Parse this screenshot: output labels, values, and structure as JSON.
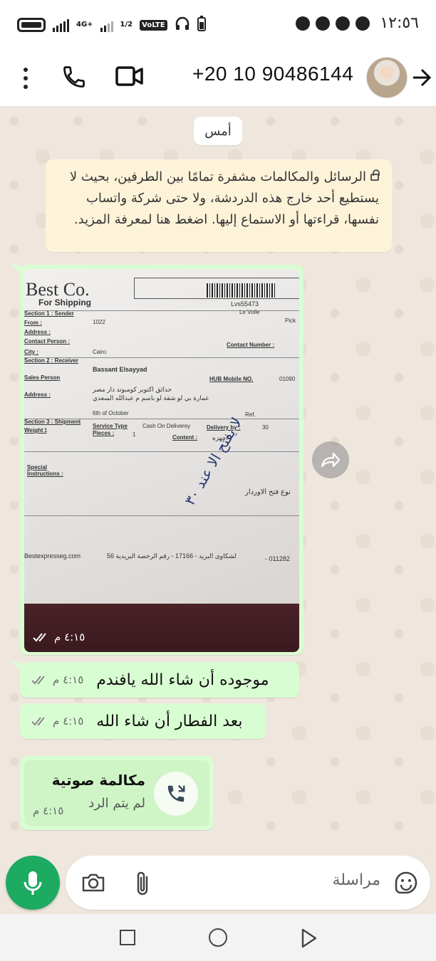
{
  "status_bar": {
    "time": "١٢:٥٦",
    "network": "4G+",
    "volte": "VoLTE",
    "sim_fraction": "1/2",
    "icons": [
      "battery-icon",
      "signal-icon",
      "headphones-icon",
      "alarm-icon",
      "facebook-icon",
      "messenger-icon"
    ]
  },
  "header": {
    "contact_number": "+20 10 90486144",
    "icons": [
      "menu-icon",
      "phone-icon",
      "video-icon",
      "avatar",
      "back-arrow-icon"
    ]
  },
  "chat": {
    "day_label": "أمس",
    "encryption_notice": "الرسائل والمكالمات مشفرة تمامًا بين الطرفين، بحيث لا يستطيع أحد خارج هذه الدردشة، ولا حتى شركة واتساب نفسها، قراءتها أو الاستماع إليها. اضغط هنا لمعرفة المزيد.",
    "messages": [
      {
        "type": "image",
        "time": "٤:١٥ م",
        "receipt": "double-check",
        "photo": {
          "logo": "Best Co.",
          "logo_sub": "For Shipping",
          "tracking": "Lvs55473",
          "tracking_sub": "Le Volle",
          "pick": "Pick",
          "section1": "Section 1 : Sender",
          "from_label": "From :",
          "from_value": "1022",
          "address_label": "Address :",
          "contact_person": "Contact Person :",
          "contact_number": "Contact Number :",
          "city_label": "City :",
          "city_value": "Cairo",
          "section2": "Section 2 : Receiver",
          "receiver_name": "Bassant Elsayyad",
          "sales_person": "Sales Person",
          "hub_mobile": "HUB Mobile NO.",
          "hub_mobile_value": "01090",
          "address2_label": "Address :",
          "address_ar_1": "حدائق اكتوبر كومبوند دار مصر",
          "address_ar_2": "عمارة بي لو شقة لو باسم م عبدالله السعدي",
          "area": "6th of October",
          "ref": "Ref.",
          "section3": "Section 3 : Shipment",
          "weight_label": "Weight :",
          "weight_value": "1",
          "service_type": "Service Type",
          "service_value": "Cash On Deliverey",
          "delivery_by": "Delivery by :",
          "delivery_value": "30",
          "pieces": "Pieces :",
          "pieces_value": "1",
          "content": "Content :",
          "content_value": "اجهزه",
          "special": "Special Instructions :",
          "order_type": "نوع فتح الاوردار",
          "handwriting": "لا يفتح الا عند ٣٠",
          "footer_site": "Bestexpresseg.com",
          "footer_ar": "لشكاوى البريد - 17166 - رقم الرخصة البريدية 56",
          "footer_phone": "- 011282"
        }
      },
      {
        "type": "text",
        "text": "موجوده أن شاء الله يافندم",
        "time": "٤:١٥ م",
        "receipt": "double-check"
      },
      {
        "type": "text",
        "text": "بعد الفطار أن شاء الله",
        "time": "٤:١٥ م",
        "receipt": "double-check"
      },
      {
        "type": "call",
        "title": "مكالمة صوتية",
        "subtitle": "لم يتم الرد",
        "time": "٤:١٥ م"
      }
    ]
  },
  "input_bar": {
    "placeholder": "مراسلة",
    "icons": [
      "mic-icon",
      "camera-icon",
      "attach-icon",
      "sticker-icon"
    ]
  },
  "nav_bar": {
    "icons": [
      "recents-icon",
      "home-icon",
      "back-icon"
    ]
  },
  "colors": {
    "bubble_in": "#d9fdd3",
    "notice_bg": "#fdf3d9",
    "mic_green": "#1daa61",
    "chat_bg": "#efe7de"
  }
}
